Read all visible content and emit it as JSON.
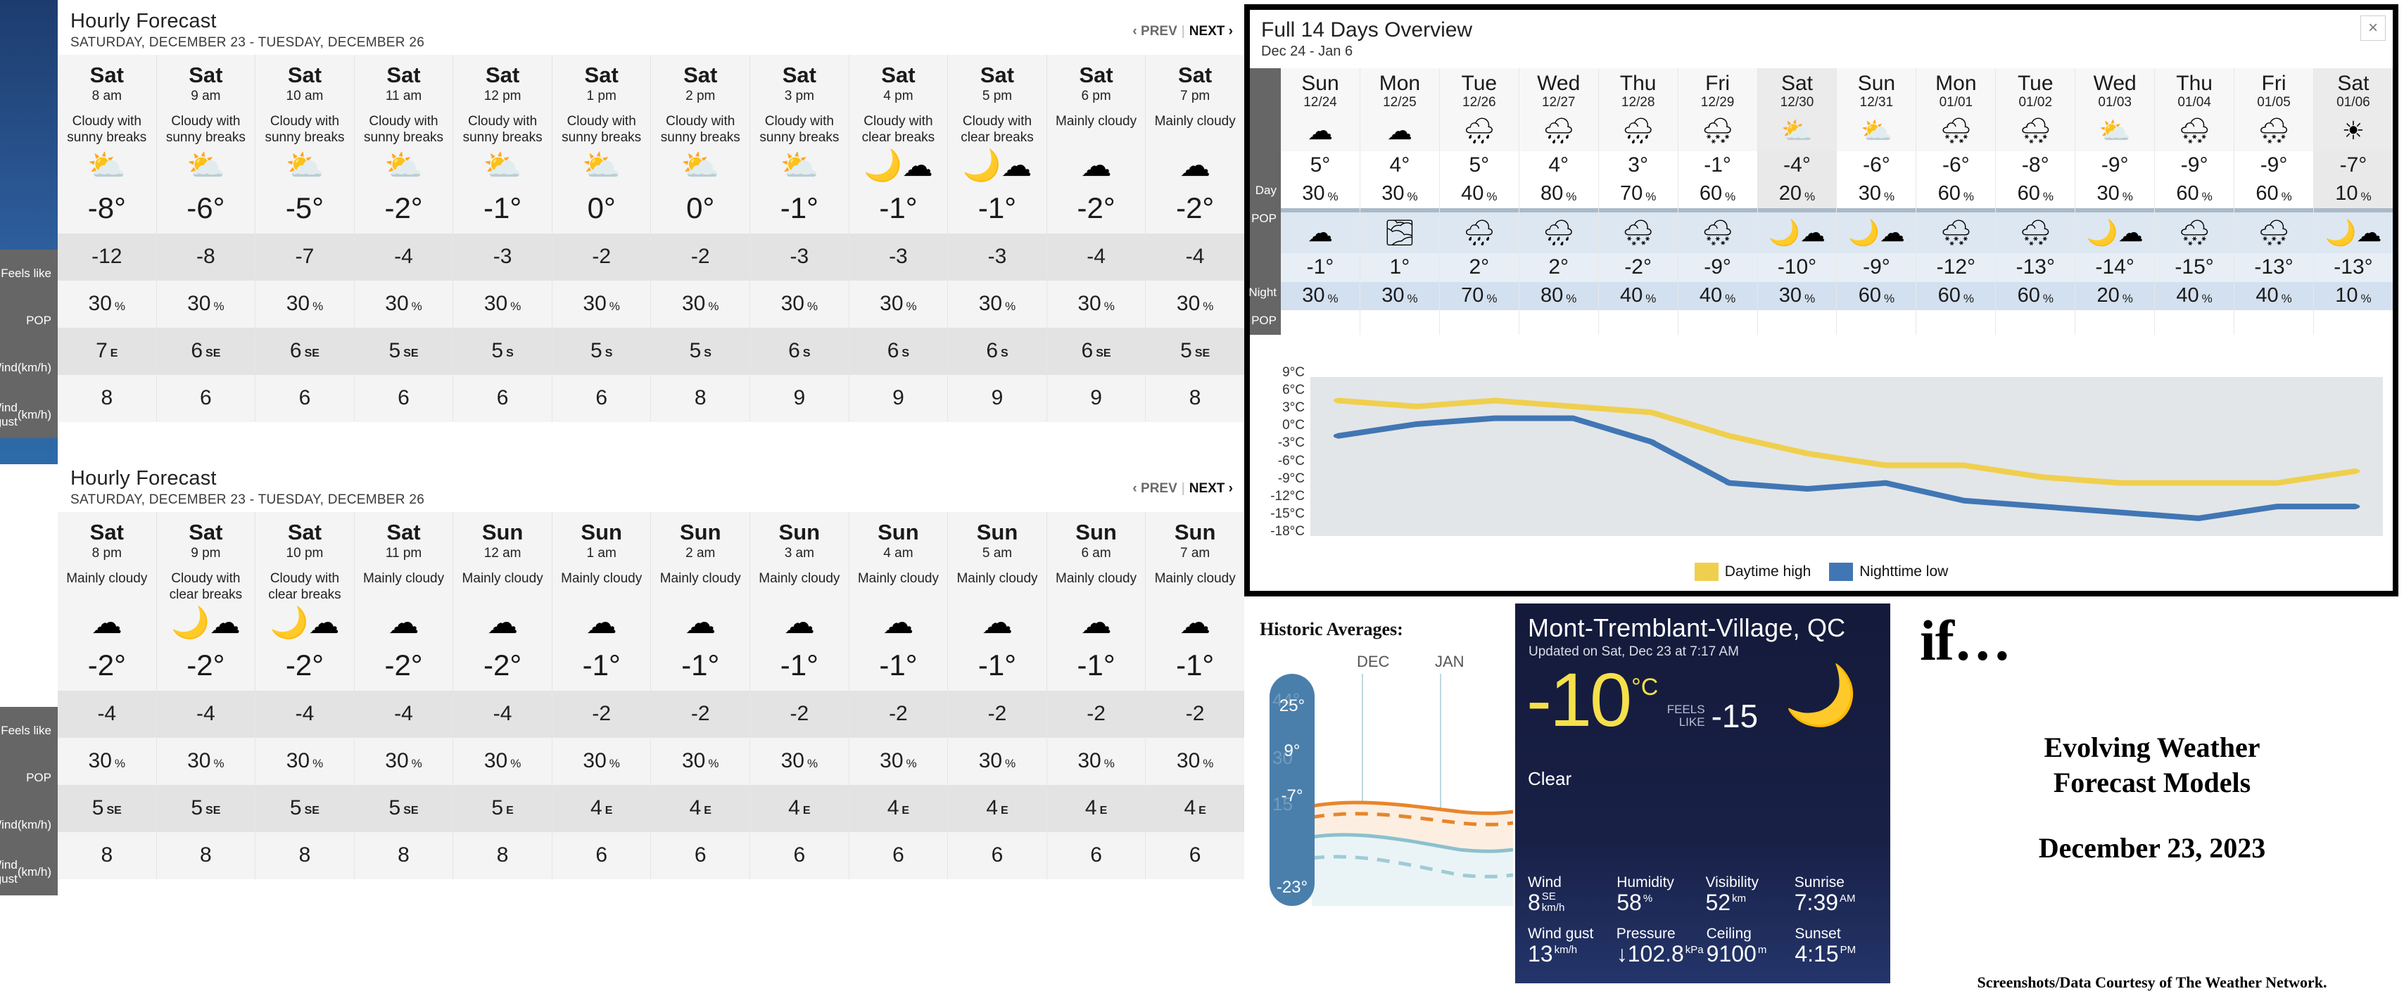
{
  "hourly_row_labels": [
    "Feels like",
    "POP",
    "Wind\n(km/h)",
    "Wind gust\n(km/h)"
  ],
  "hourly_panels": [
    {
      "title": "Hourly Forecast",
      "subtitle": "SATURDAY, DECEMBER 23 - TUESDAY, DECEMBER 26",
      "prev": "‹ PREV",
      "next": "NEXT ›",
      "separator": "|",
      "columns": [
        {
          "day": "Sat",
          "hour": "8 am",
          "condition": "Cloudy with sunny breaks",
          "icon": "sun-behind-cloud-icon",
          "temp": "-8°",
          "feels": "-12",
          "pop": "30",
          "pop_unit": "%",
          "wind": "7",
          "wind_dir": "E",
          "gust": "8"
        },
        {
          "day": "Sat",
          "hour": "9 am",
          "condition": "Cloudy with sunny breaks",
          "icon": "sun-behind-cloud-icon",
          "temp": "-6°",
          "feels": "-8",
          "pop": "30",
          "pop_unit": "%",
          "wind": "6",
          "wind_dir": "SE",
          "gust": "6"
        },
        {
          "day": "Sat",
          "hour": "10 am",
          "condition": "Cloudy with sunny breaks",
          "icon": "sun-behind-cloud-icon",
          "temp": "-5°",
          "feels": "-7",
          "pop": "30",
          "pop_unit": "%",
          "wind": "6",
          "wind_dir": "SE",
          "gust": "6"
        },
        {
          "day": "Sat",
          "hour": "11 am",
          "condition": "Cloudy with sunny breaks",
          "icon": "sun-behind-cloud-icon",
          "temp": "-2°",
          "feels": "-4",
          "pop": "30",
          "pop_unit": "%",
          "wind": "5",
          "wind_dir": "SE",
          "gust": "6"
        },
        {
          "day": "Sat",
          "hour": "12 pm",
          "condition": "Cloudy with sunny breaks",
          "icon": "sun-behind-cloud-icon",
          "temp": "-1°",
          "feels": "-3",
          "pop": "30",
          "pop_unit": "%",
          "wind": "5",
          "wind_dir": "S",
          "gust": "6"
        },
        {
          "day": "Sat",
          "hour": "1 pm",
          "condition": "Cloudy with sunny breaks",
          "icon": "sun-behind-cloud-icon",
          "temp": "0°",
          "feels": "-2",
          "pop": "30",
          "pop_unit": "%",
          "wind": "5",
          "wind_dir": "S",
          "gust": "6"
        },
        {
          "day": "Sat",
          "hour": "2 pm",
          "condition": "Cloudy with sunny breaks",
          "icon": "sun-behind-cloud-icon",
          "temp": "0°",
          "feels": "-2",
          "pop": "30",
          "pop_unit": "%",
          "wind": "5",
          "wind_dir": "S",
          "gust": "8"
        },
        {
          "day": "Sat",
          "hour": "3 pm",
          "condition": "Cloudy with sunny breaks",
          "icon": "sun-behind-cloud-icon",
          "temp": "-1°",
          "feels": "-3",
          "pop": "30",
          "pop_unit": "%",
          "wind": "6",
          "wind_dir": "S",
          "gust": "9"
        },
        {
          "day": "Sat",
          "hour": "4 pm",
          "condition": "Cloudy with clear breaks",
          "icon": "moon-behind-cloud-icon",
          "temp": "-1°",
          "feels": "-3",
          "pop": "30",
          "pop_unit": "%",
          "wind": "6",
          "wind_dir": "S",
          "gust": "9"
        },
        {
          "day": "Sat",
          "hour": "5 pm",
          "condition": "Cloudy with clear breaks",
          "icon": "moon-behind-cloud-icon",
          "temp": "-1°",
          "feels": "-3",
          "pop": "30",
          "pop_unit": "%",
          "wind": "6",
          "wind_dir": "S",
          "gust": "9"
        },
        {
          "day": "Sat",
          "hour": "6 pm",
          "condition": "Mainly cloudy",
          "icon": "cloud-icon",
          "temp": "-2°",
          "feels": "-4",
          "pop": "30",
          "pop_unit": "%",
          "wind": "6",
          "wind_dir": "SE",
          "gust": "9"
        },
        {
          "day": "Sat",
          "hour": "7 pm",
          "condition": "Mainly cloudy",
          "icon": "cloud-icon",
          "temp": "-2°",
          "feels": "-4",
          "pop": "30",
          "pop_unit": "%",
          "wind": "5",
          "wind_dir": "SE",
          "gust": "8"
        }
      ]
    },
    {
      "title": "Hourly Forecast",
      "subtitle": "SATURDAY, DECEMBER 23 - TUESDAY, DECEMBER 26",
      "prev": "‹ PREV",
      "next": "NEXT ›",
      "separator": "|",
      "columns": [
        {
          "day": "Sat",
          "hour": "8 pm",
          "condition": "Mainly cloudy",
          "icon": "cloud-icon",
          "temp": "-2°",
          "feels": "-4",
          "pop": "30",
          "pop_unit": "%",
          "wind": "5",
          "wind_dir": "SE",
          "gust": "8"
        },
        {
          "day": "Sat",
          "hour": "9 pm",
          "condition": "Cloudy with clear breaks",
          "icon": "moon-behind-cloud-icon",
          "temp": "-2°",
          "feels": "-4",
          "pop": "30",
          "pop_unit": "%",
          "wind": "5",
          "wind_dir": "SE",
          "gust": "8"
        },
        {
          "day": "Sat",
          "hour": "10 pm",
          "condition": "Cloudy with clear breaks",
          "icon": "moon-behind-cloud-icon",
          "temp": "-2°",
          "feels": "-4",
          "pop": "30",
          "pop_unit": "%",
          "wind": "5",
          "wind_dir": "SE",
          "gust": "8"
        },
        {
          "day": "Sat",
          "hour": "11 pm",
          "condition": "Mainly cloudy",
          "icon": "cloud-icon",
          "temp": "-2°",
          "feels": "-4",
          "pop": "30",
          "pop_unit": "%",
          "wind": "5",
          "wind_dir": "SE",
          "gust": "8"
        },
        {
          "day": "Sun",
          "hour": "12 am",
          "condition": "Mainly cloudy",
          "icon": "cloud-icon",
          "temp": "-2°",
          "feels": "-4",
          "pop": "30",
          "pop_unit": "%",
          "wind": "5",
          "wind_dir": "E",
          "gust": "8"
        },
        {
          "day": "Sun",
          "hour": "1 am",
          "condition": "Mainly cloudy",
          "icon": "cloud-icon",
          "temp": "-1°",
          "feels": "-2",
          "pop": "30",
          "pop_unit": "%",
          "wind": "4",
          "wind_dir": "E",
          "gust": "6"
        },
        {
          "day": "Sun",
          "hour": "2 am",
          "condition": "Mainly cloudy",
          "icon": "cloud-icon",
          "temp": "-1°",
          "feels": "-2",
          "pop": "30",
          "pop_unit": "%",
          "wind": "4",
          "wind_dir": "E",
          "gust": "6"
        },
        {
          "day": "Sun",
          "hour": "3 am",
          "condition": "Mainly cloudy",
          "icon": "cloud-icon",
          "temp": "-1°",
          "feels": "-2",
          "pop": "30",
          "pop_unit": "%",
          "wind": "4",
          "wind_dir": "E",
          "gust": "6"
        },
        {
          "day": "Sun",
          "hour": "4 am",
          "condition": "Mainly cloudy",
          "icon": "cloud-icon",
          "temp": "-1°",
          "feels": "-2",
          "pop": "30",
          "pop_unit": "%",
          "wind": "4",
          "wind_dir": "E",
          "gust": "6"
        },
        {
          "day": "Sun",
          "hour": "5 am",
          "condition": "Mainly cloudy",
          "icon": "cloud-icon",
          "temp": "-1°",
          "feels": "-2",
          "pop": "30",
          "pop_unit": "%",
          "wind": "4",
          "wind_dir": "E",
          "gust": "6"
        },
        {
          "day": "Sun",
          "hour": "6 am",
          "condition": "Mainly cloudy",
          "icon": "cloud-icon",
          "temp": "-1°",
          "feels": "-2",
          "pop": "30",
          "pop_unit": "%",
          "wind": "4",
          "wind_dir": "E",
          "gust": "6"
        },
        {
          "day": "Sun",
          "hour": "7 am",
          "condition": "Mainly cloudy",
          "icon": "cloud-icon",
          "temp": "-1°",
          "feels": "-2",
          "pop": "30",
          "pop_unit": "%",
          "wind": "4",
          "wind_dir": "E",
          "gust": "6"
        }
      ]
    }
  ],
  "overview": {
    "title": "Full 14 Days Overview",
    "subtitle": "Dec 24 - Jan 6",
    "close_label": "×",
    "side_labels": {
      "day": "Day",
      "day_pop": "POP",
      "night": "Night",
      "night_pop": "POP"
    },
    "pop_unit": "%",
    "days": [
      {
        "name": "Sun",
        "date": "12/24",
        "day_icon": "cloud-icon",
        "day_temp": "5°",
        "day_pop": "30",
        "night_icon": "cloud-icon",
        "night_temp": "-1°",
        "night_pop": "30"
      },
      {
        "name": "Mon",
        "date": "12/25",
        "day_icon": "cloud-icon",
        "day_temp": "4°",
        "day_pop": "30",
        "night_icon": "fog-icon",
        "night_temp": "1°",
        "night_pop": "30"
      },
      {
        "name": "Tue",
        "date": "12/26",
        "day_icon": "rain-cloud-icon",
        "day_temp": "5°",
        "day_pop": "40",
        "night_icon": "rain-cloud-icon",
        "night_temp": "2°",
        "night_pop": "70"
      },
      {
        "name": "Wed",
        "date": "12/27",
        "day_icon": "rain-cloud-icon",
        "day_temp": "4°",
        "day_pop": "80",
        "night_icon": "heavy-rain-cloud-icon",
        "night_temp": "2°",
        "night_pop": "80"
      },
      {
        "name": "Thu",
        "date": "12/28",
        "day_icon": "rain-cloud-icon",
        "day_temp": "3°",
        "day_pop": "70",
        "night_icon": "rain-snow-cloud-icon",
        "night_temp": "-2°",
        "night_pop": "40"
      },
      {
        "name": "Fri",
        "date": "12/29",
        "day_icon": "rain-snow-cloud-icon",
        "day_temp": "-1°",
        "day_pop": "60",
        "night_icon": "rain-snow-cloud-icon",
        "night_temp": "-9°",
        "night_pop": "40"
      },
      {
        "name": "Sat",
        "date": "12/30",
        "day_icon": "sun-behind-cloud-icon",
        "day_temp": "-4°",
        "day_pop": "20",
        "night_icon": "moon-behind-cloud-icon",
        "night_temp": "-10°",
        "night_pop": "30"
      },
      {
        "name": "Sun",
        "date": "12/31",
        "day_icon": "sun-behind-cloud-icon",
        "day_temp": "-6°",
        "day_pop": "30",
        "night_icon": "moon-behind-cloud-icon",
        "night_temp": "-9°",
        "night_pop": "60"
      },
      {
        "name": "Mon",
        "date": "01/01",
        "day_icon": "snow-cloud-icon",
        "day_temp": "-6°",
        "day_pop": "60",
        "night_icon": "snow-cloud-icon",
        "night_temp": "-12°",
        "night_pop": "60"
      },
      {
        "name": "Tue",
        "date": "01/02",
        "day_icon": "snow-cloud-icon",
        "day_temp": "-8°",
        "day_pop": "60",
        "night_icon": "snow-cloud-icon",
        "night_temp": "-13°",
        "night_pop": "60"
      },
      {
        "name": "Wed",
        "date": "01/03",
        "day_icon": "sun-behind-cloud-icon",
        "day_temp": "-9°",
        "day_pop": "30",
        "night_icon": "moon-behind-cloud-icon",
        "night_temp": "-14°",
        "night_pop": "20"
      },
      {
        "name": "Thu",
        "date": "01/04",
        "day_icon": "sun-behind-snow-cloud-icon",
        "day_temp": "-9°",
        "day_pop": "60",
        "night_icon": "moon-behind-snow-cloud-icon",
        "night_temp": "-15°",
        "night_pop": "40"
      },
      {
        "name": "Fri",
        "date": "01/05",
        "day_icon": "snow-cloud-icon",
        "day_temp": "-9°",
        "day_pop": "60",
        "night_icon": "moon-behind-snow-cloud-icon",
        "night_temp": "-13°",
        "night_pop": "40"
      },
      {
        "name": "Sat",
        "date": "01/06",
        "day_icon": "sun-icon",
        "day_temp": "-7°",
        "day_pop": "10",
        "night_icon": "moon-behind-cloud-icon",
        "night_temp": "-13°",
        "night_pop": "10"
      }
    ],
    "legend": [
      {
        "label": "Daytime high",
        "color": "#f0cf4e"
      },
      {
        "label": "Nighttime low",
        "color": "#4176b4"
      }
    ]
  },
  "chart_data": {
    "type": "line",
    "title": "",
    "xlabel": "",
    "ylabel": "",
    "ylim": [
      -18,
      9
    ],
    "yticks": [
      9,
      6,
      3,
      0,
      -3,
      -6,
      -9,
      -12,
      -15,
      -18
    ],
    "ytick_labels": [
      "9°C",
      "6°C",
      "3°C",
      "0°C",
      "-3°C",
      "-6°C",
      "-9°C",
      "-12°C",
      "-15°C",
      "-18°C"
    ],
    "categories": [
      "12/24",
      "12/25",
      "12/26",
      "12/27",
      "12/28",
      "12/29",
      "12/30",
      "12/31",
      "01/01",
      "01/02",
      "01/03",
      "01/04",
      "01/05",
      "01/06"
    ],
    "grid": false,
    "legend_position": "bottom",
    "series": [
      {
        "name": "Daytime high",
        "color": "#f0cf4e",
        "values": [
          5,
          4,
          5,
          4,
          3,
          -1,
          -4,
          -6,
          -6,
          -8,
          -9,
          -9,
          -9,
          -7
        ]
      },
      {
        "name": "Nighttime low",
        "color": "#4176b4",
        "values": [
          -1,
          1,
          2,
          2,
          -2,
          -9,
          -10,
          -9,
          -12,
          -13,
          -14,
          -15,
          -13,
          -13
        ]
      }
    ]
  },
  "historic": {
    "title": "Historic Averages:",
    "months": [
      "DEC",
      "JAN"
    ],
    "scale_labels": [
      "25°",
      "9°",
      "-7°",
      "-23°"
    ],
    "ghost_labels": [
      "44°",
      "30",
      "15"
    ]
  },
  "current": {
    "city": "Mont-Tremblant-Village, QC",
    "updated": "Updated on Sat, Dec 23 at 7:17 AM",
    "temp": "-10",
    "unit": "°C",
    "feels_like_label_1": "FEELS",
    "feels_like_label_2": "LIKE",
    "feels_like_value": "-15",
    "condition": "Clear",
    "icon": "crescent-moon-icon",
    "stats": [
      [
        {
          "label": "Wind",
          "value": "8",
          "unit_top": "SE",
          "unit_bottom": "km/h"
        },
        {
          "label": "Humidity",
          "value": "58",
          "unit_top": "%",
          "unit_bottom": ""
        },
        {
          "label": "Visibility",
          "value": "52",
          "unit_top": "km",
          "unit_bottom": ""
        },
        {
          "label": "Sunrise",
          "value": "7:39",
          "unit_top": "AM",
          "unit_bottom": ""
        }
      ],
      [
        {
          "label": "Wind gust",
          "value": "13",
          "unit_top": "km/h",
          "unit_bottom": ""
        },
        {
          "label": "Pressure",
          "value": "↓102.8",
          "unit_top": "kPa",
          "unit_bottom": ""
        },
        {
          "label": "Ceiling",
          "value": "9100",
          "unit_top": "m",
          "unit_bottom": ""
        },
        {
          "label": "Sunset",
          "value": "4:15",
          "unit_top": "PM",
          "unit_bottom": ""
        }
      ]
    ]
  },
  "title_block": {
    "if_text": "if…",
    "headline": "Evolving Weather\nForecast Models",
    "date": "December 23, 2023",
    "credit": "Screenshots/Data Courtesy of The Weather Network."
  }
}
